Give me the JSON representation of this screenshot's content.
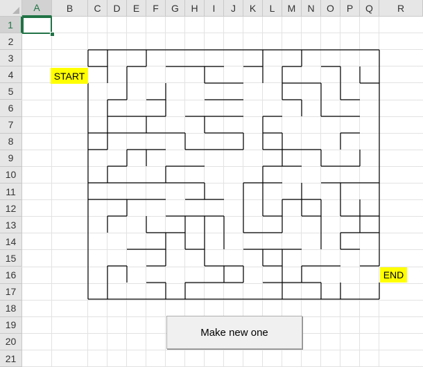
{
  "spreadsheet": {
    "columns": [
      "A",
      "B",
      "C",
      "D",
      "E",
      "F",
      "G",
      "H",
      "I",
      "J",
      "K",
      "L",
      "M",
      "N",
      "O",
      "P",
      "Q",
      "R"
    ],
    "rows": [
      "1",
      "2",
      "3",
      "4",
      "5",
      "6",
      "7",
      "8",
      "9",
      "10",
      "11",
      "12",
      "13",
      "14",
      "15",
      "16",
      "17",
      "18",
      "19",
      "20",
      "21"
    ],
    "active_cell": "A1"
  },
  "maze": {
    "start_label": "START",
    "end_label": "END",
    "label_color": "#ffff00",
    "wall_color": "#000000"
  },
  "button": {
    "label": "Make new one"
  },
  "colors": {
    "accent": "#217346",
    "header_bg": "#e6e6e6",
    "gridline": "#e2e2e2"
  }
}
